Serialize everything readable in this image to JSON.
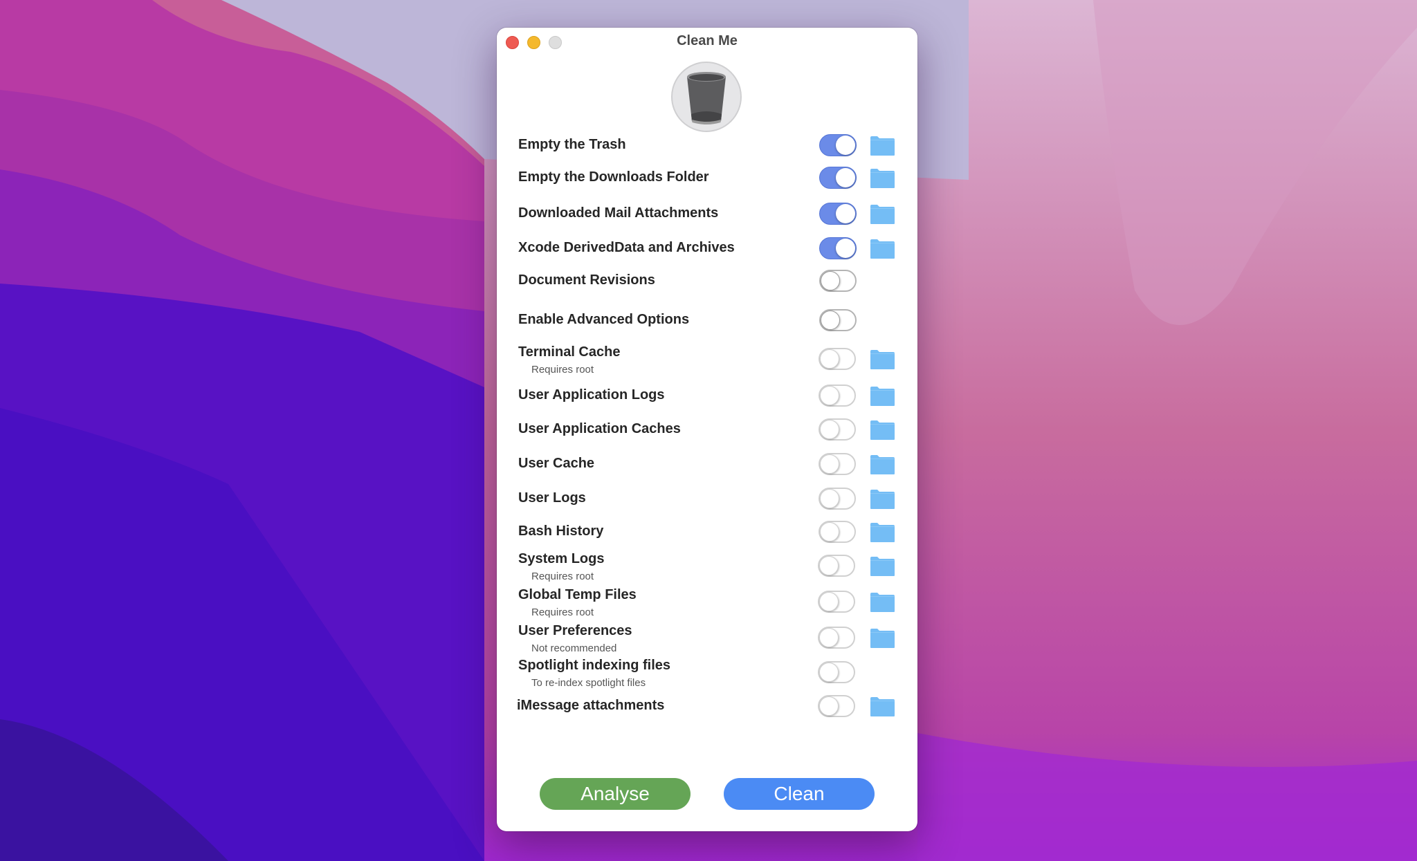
{
  "window": {
    "title": "Clean Me",
    "app_icon": "trash-icon"
  },
  "colors": {
    "toggle_on": "#6b8be8",
    "folder": "#74bdf5",
    "analyse_button": "#65a556",
    "clean_button": "#4b8bf4",
    "close": "#ee5a52",
    "minimize": "#f4b82c",
    "zoom": "#dedede"
  },
  "options": [
    {
      "label": "Empty the Trash",
      "sub": "",
      "on": true,
      "enabled": true,
      "folder": true
    },
    {
      "label": "Empty the Downloads Folder",
      "sub": "",
      "on": true,
      "enabled": true,
      "folder": true
    },
    {
      "label": "Downloaded Mail Attachments",
      "sub": "",
      "on": true,
      "enabled": true,
      "folder": true
    },
    {
      "label": "Xcode DerivedData and Archives",
      "sub": "",
      "on": true,
      "enabled": true,
      "folder": true
    },
    {
      "label": "Document Revisions",
      "sub": "",
      "on": false,
      "enabled": true,
      "folder": false
    },
    {
      "label": "Enable Advanced Options",
      "sub": "",
      "on": false,
      "enabled": true,
      "folder": false
    },
    {
      "label": "Terminal Cache",
      "sub": "Requires root",
      "on": false,
      "enabled": false,
      "folder": true
    },
    {
      "label": "User Application Logs",
      "sub": "",
      "on": false,
      "enabled": false,
      "folder": true
    },
    {
      "label": "User Application Caches",
      "sub": "",
      "on": false,
      "enabled": false,
      "folder": true
    },
    {
      "label": "User Cache",
      "sub": "",
      "on": false,
      "enabled": false,
      "folder": true
    },
    {
      "label": "User Logs",
      "sub": "",
      "on": false,
      "enabled": false,
      "folder": true
    },
    {
      "label": "Bash History",
      "sub": "",
      "on": false,
      "enabled": false,
      "folder": true
    },
    {
      "label": "System Logs",
      "sub": "Requires root",
      "on": false,
      "enabled": false,
      "folder": true
    },
    {
      "label": "Global Temp Files",
      "sub": "Requires root",
      "on": false,
      "enabled": false,
      "folder": true
    },
    {
      "label": "User Preferences",
      "sub": "Not recommended",
      "on": false,
      "enabled": false,
      "folder": true
    },
    {
      "label": "Spotlight indexing files",
      "sub": "To re-index spotlight files",
      "on": false,
      "enabled": false,
      "folder": false
    },
    {
      "label": "iMessage attachments",
      "sub": "",
      "on": false,
      "enabled": false,
      "folder": true
    }
  ],
  "buttons": {
    "analyse": "Analyse",
    "clean": "Clean"
  }
}
